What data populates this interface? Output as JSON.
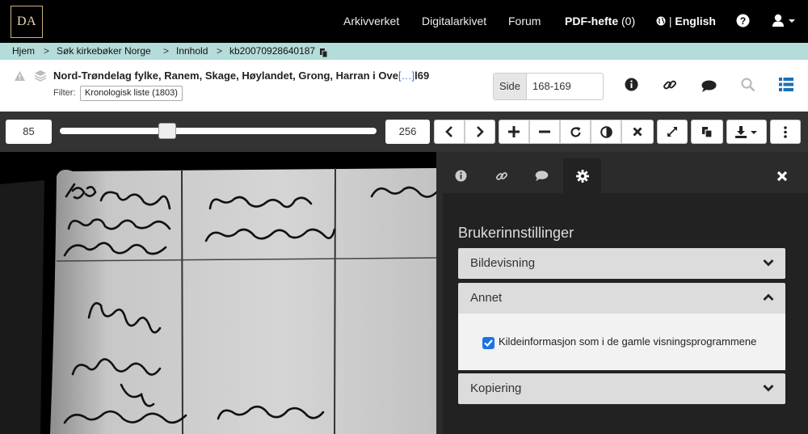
{
  "nav": {
    "logo": "DA",
    "items": [
      "Arkivverket",
      "Digitalarkivet",
      "Forum"
    ],
    "pdf_label": "PDF-hefte",
    "pdf_count": "(0)",
    "language_sep": "|",
    "language": "English"
  },
  "breadcrumb": {
    "items": [
      "Hjem",
      "Søk kirkebøker Norge",
      "Innhold",
      "kb20070928640187"
    ],
    "separator": ">"
  },
  "header": {
    "title": "Nord-Trøndelag fylke, Ranem, Skage, Høylandet, Grong, Harran i Ove",
    "title_ellipsis": "[…]",
    "title_end": "l69",
    "filter_label": "Filter:",
    "filter_value": "Kronologisk liste (1803)",
    "side_label": "Side",
    "side_value": "168-169"
  },
  "toolbar": {
    "zoom_min": "85",
    "zoom_max": "256",
    "slider_level_percent": 33
  },
  "panel": {
    "title": "Brukerinnstillinger",
    "sections": [
      {
        "label": "Bildevisning",
        "expanded": false
      },
      {
        "label": "Annet",
        "expanded": true
      },
      {
        "label": "Kopiering",
        "expanded": false
      }
    ],
    "checkbox_label": "Kildeinformasjon som i de gamle visningsprogrammene",
    "checkbox_checked": true
  },
  "colors": {
    "topbar": "#000000",
    "breadcrumb": "#b4dcd9",
    "accent_link": "#2c7bd6",
    "toolbar": "#333333",
    "panel": "#2b2b2b",
    "checkbox": "#1a73e8"
  }
}
